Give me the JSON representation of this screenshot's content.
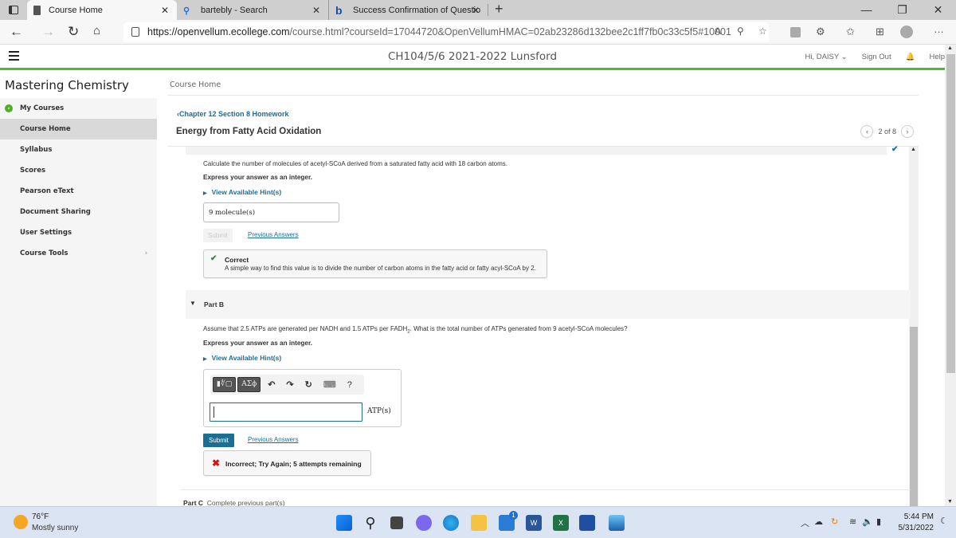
{
  "browser": {
    "tabs": [
      {
        "title": "Course Home",
        "active": true
      },
      {
        "title": "bartebly - Search",
        "active": false
      },
      {
        "title": "Success Confirmation of Questio",
        "active": false
      }
    ],
    "new_tab": "+",
    "url_domain": "https://openvellum.ecollege.com",
    "url_path": "/course.html?courseId=17044720&OpenVellumHMAC=02ab23286d132bee2c1ff7fb0c33c5f5#10001",
    "window_controls": {
      "minimize": "—",
      "restore": "❐",
      "close": "✕"
    }
  },
  "appbar": {
    "course_title": "CH104/5/6 2021-2022 Lunsford",
    "user_menu": "Hi, DAISY ⌄",
    "sign_out": "Sign Out",
    "help": "Help"
  },
  "sidebar": {
    "brand": "Mastering Chemistry",
    "items": [
      {
        "label": "My Courses",
        "back": true
      },
      {
        "label": "Course Home",
        "active": true
      },
      {
        "label": "Syllabus"
      },
      {
        "label": "Scores"
      },
      {
        "label": "Pearson eText"
      },
      {
        "label": "Document Sharing"
      },
      {
        "label": "User Settings"
      },
      {
        "label": "Course Tools",
        "chevron": "›"
      }
    ]
  },
  "main": {
    "breadcrumb": "Course Home",
    "assignment_link": "‹Chapter 12 Section 8 Homework",
    "assignment_title": "Energy from Fatty Acid Oxidation",
    "pager": {
      "prev": "‹",
      "text": "2 of 8",
      "next": "›"
    },
    "partA": {
      "status_icon": "✔",
      "question": "Calculate the number of molecules of acetyl-SCoA derived from a saturated fatty acid with 18 carbon atoms.",
      "instruction": "Express your answer as an integer.",
      "hint_link": "View Available Hint(s)",
      "answer_value": "9  molecule(s)",
      "submit_label": "Submit",
      "previous_answers": "Previous Answers",
      "feedback": {
        "icon": "✔",
        "heading": "Correct",
        "body": "A simple way to find this value is to divide the number of carbon atoms in the fatty acid or fatty acyl-SCoA by 2."
      }
    },
    "partB": {
      "label": "Part B",
      "question_pre": "Assume that 2.5 ATPs are generated per NADH and 1.5 ATPs per FADH",
      "question_sub": "2",
      "question_post": ". What is the total number of ATPs generated from 9 acetyl-SCoA molecules?",
      "instruction": "Express your answer as an integer.",
      "hint_link": "View Available Hint(s)",
      "toolbar": {
        "templates": "▮∜▢",
        "symbols": "ΑΣϕ",
        "undo": "↶",
        "redo": "↷",
        "reset": "↻",
        "keyboard": "⌨",
        "help": "?"
      },
      "answer_value": "",
      "unit": "ATP(s)",
      "submit_label": "Submit",
      "previous_answers": "Previous Answers",
      "feedback": {
        "icon": "✖",
        "text": "Incorrect; Try Again; 5 attempts remaining"
      }
    },
    "partC": {
      "label": "Part C",
      "status": "Complete previous part(s)"
    }
  },
  "taskbar": {
    "weather_temp": "76°F",
    "weather_desc": "Mostly sunny",
    "mail_badge": "1",
    "time": "5:44 PM",
    "date": "5/31/2022"
  },
  "colors": {
    "accent": "#1a6f93",
    "appbar_border": "#52b82f",
    "correct": "#2e8b2e",
    "incorrect": "#dd1111"
  }
}
